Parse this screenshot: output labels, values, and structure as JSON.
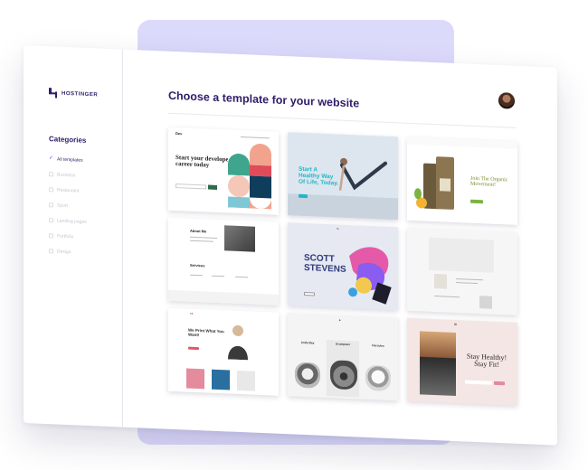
{
  "brand": {
    "name": "HOSTINGER"
  },
  "header": {
    "title": "Choose a template for your website"
  },
  "sidebar": {
    "title": "Categories",
    "items": [
      {
        "label": "All templates",
        "checked": true
      },
      {
        "label": "Business",
        "checked": false
      },
      {
        "label": "Restaurant",
        "checked": false
      },
      {
        "label": "Sport",
        "checked": false
      },
      {
        "label": "Landing pages",
        "checked": false
      },
      {
        "label": "Portfolio",
        "checked": false
      },
      {
        "label": "Design",
        "checked": false
      }
    ]
  },
  "templates": [
    {
      "headline": "Start your developer career today",
      "brand": "Dev"
    },
    {
      "headline": "Start A Healthy Way Of Life, Today."
    },
    {
      "headline": "Join The Organic Movement!"
    },
    {
      "headline": "About Me",
      "section": "Services"
    },
    {
      "headline": "SCOTT STEVENS"
    },
    {
      "headline": ""
    },
    {
      "headline": "We Print What You Want!"
    },
    {
      "labels": [
        "Andy Bay",
        "Grumpster",
        "Hercules"
      ]
    },
    {
      "headline": "Stay Healthy! Stay Fit!"
    }
  ],
  "colors": {
    "accent": "#673de6",
    "title": "#2f1c6a",
    "bg_panel": "#dcdafb"
  }
}
